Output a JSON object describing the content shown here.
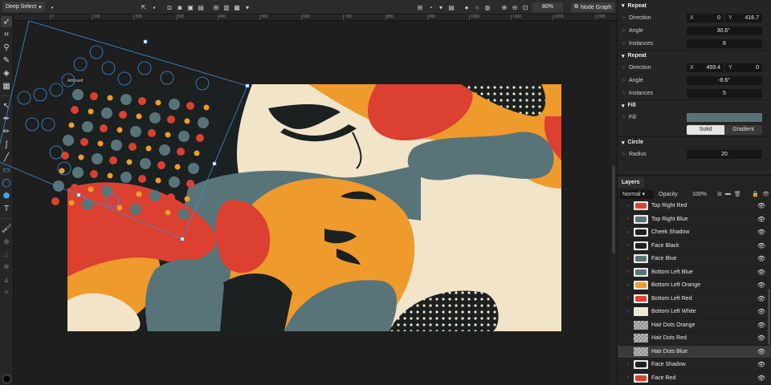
{
  "toolbar": {
    "selection_mode": "Deep Select",
    "zoom": "80%",
    "node_graph_label": "Node Graph"
  },
  "ruler": {
    "labels": [
      "0",
      "100",
      "200",
      "300",
      "400",
      "500",
      "600",
      "700",
      "800",
      "900",
      "1000",
      "1100",
      "1200",
      "1300",
      "1400",
      "1500",
      "1600"
    ]
  },
  "canvas": {
    "artboard_label": "Artboard"
  },
  "properties": {
    "repeat1": {
      "title": "Repeat",
      "direction_label": "Direction",
      "dir_x_label": "X",
      "dir_x": "0",
      "dir_y_label": "Y",
      "dir_y": "416.7",
      "angle_label": "Angle",
      "angle": "30.6°",
      "instances_label": "Instances",
      "instances": "8"
    },
    "repeat2": {
      "title": "Repeat",
      "direction_label": "Direction",
      "dir_x_label": "X",
      "dir_x": "459.4",
      "dir_y_label": "Y",
      "dir_y": "0",
      "angle_label": "Angle",
      "angle": "-8.6°",
      "instances_label": "Instances",
      "instances": "5"
    },
    "fill": {
      "title": "Fill",
      "fill_label": "Fill",
      "color": "#587479",
      "solid_label": "Solid",
      "gradient_label": "Gradient"
    },
    "circle": {
      "title": "Circle",
      "radius_label": "Radius",
      "radius": "20"
    }
  },
  "layers": {
    "tab_label": "Layers",
    "blend_mode": "Normal",
    "opacity_label": "Opacity",
    "opacity_value": "100%",
    "items": [
      {
        "name": "Top Right Red",
        "thumb": "red",
        "expandable": true,
        "selected": false
      },
      {
        "name": "Top Right Blue",
        "thumb": "blue",
        "expandable": true,
        "selected": false
      },
      {
        "name": "Cheek Shadow",
        "thumb": "dark",
        "expandable": true,
        "selected": false
      },
      {
        "name": "Face Black",
        "thumb": "dark",
        "expandable": true,
        "selected": false
      },
      {
        "name": "Face Blue",
        "thumb": "blue",
        "expandable": true,
        "selected": false
      },
      {
        "name": "Bottom Left Blue",
        "thumb": "blue",
        "expandable": true,
        "selected": false
      },
      {
        "name": "Bottom Left Orange",
        "thumb": "orange",
        "expandable": true,
        "selected": false
      },
      {
        "name": "Bottom Left Red",
        "thumb": "red",
        "expandable": true,
        "selected": false
      },
      {
        "name": "Bottom Left White",
        "thumb": "cream",
        "expandable": true,
        "selected": false
      },
      {
        "name": "Hair Dots Orange",
        "thumb": "checker",
        "expandable": false,
        "selected": false
      },
      {
        "name": "Hair Dots Red",
        "thumb": "checker",
        "expandable": false,
        "selected": false
      },
      {
        "name": "Hair Dots Blue",
        "thumb": "checker",
        "expandable": false,
        "selected": true
      },
      {
        "name": "Face Shadow",
        "thumb": "dark",
        "expandable": true,
        "selected": false
      },
      {
        "name": "Face Red",
        "thumb": "red",
        "expandable": true,
        "selected": false
      }
    ]
  },
  "colors": {
    "cream": "#f2e4c8",
    "orange": "#ee9a2c",
    "red": "#dc4030",
    "blue": "#587479",
    "dark": "#1b2021",
    "selection": "#3a8fd6"
  }
}
